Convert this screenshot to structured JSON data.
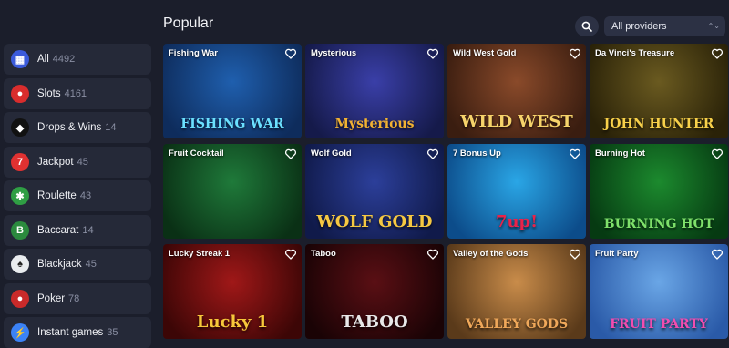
{
  "sidebar": {
    "items": [
      {
        "label": "All",
        "count": "4492",
        "icon": "all-grid-icon",
        "color": "#3b5bdb"
      },
      {
        "label": "Slots",
        "count": "4161",
        "icon": "cherries-icon",
        "color": "#d92d2d"
      },
      {
        "label": "Drops & Wins",
        "count": "14",
        "icon": "drops-wins-icon",
        "color": "#111111"
      },
      {
        "label": "Jackpot",
        "count": "45",
        "icon": "jackpot-777-icon",
        "color": "#e03131"
      },
      {
        "label": "Roulette",
        "count": "43",
        "icon": "roulette-icon",
        "color": "#2f9e44"
      },
      {
        "label": "Baccarat",
        "count": "14",
        "icon": "baccarat-icon",
        "color": "#2b8a3e"
      },
      {
        "label": "Blackjack",
        "count": "45",
        "icon": "cards-icon",
        "color": "#e9ecef"
      },
      {
        "label": "Poker",
        "count": "78",
        "icon": "poker-chip-icon",
        "color": "#c92a2a"
      },
      {
        "label": "Instant games",
        "count": "35",
        "icon": "lightning-icon",
        "color": "#3b82f6"
      }
    ]
  },
  "main": {
    "title": "Popular",
    "provider_select": {
      "value": "All providers"
    },
    "games": [
      {
        "name": "Fishing War",
        "logo": "FISHING WAR",
        "bg1": "#1f5fae",
        "bg2": "#0e2c5c",
        "logo_color": "#6be0ff"
      },
      {
        "name": "Mysterious",
        "logo": "Mysterious",
        "bg1": "#3a3fa8",
        "bg2": "#151a4a",
        "logo_color": "#f2b233"
      },
      {
        "name": "Wild West Gold",
        "logo": "WILD WEST",
        "bg1": "#8a4a2a",
        "bg2": "#3a1d10",
        "logo_color": "#f6d36b"
      },
      {
        "name": "Da Vinci's Treasure",
        "logo": "JOHN HUNTER",
        "bg1": "#6a5a20",
        "bg2": "#2a2208",
        "logo_color": "#f7d04a"
      },
      {
        "name": "Fruit Cocktail",
        "logo": "",
        "bg1": "#1f7a3a",
        "bg2": "#0a3015",
        "logo_color": "#ff3b3b"
      },
      {
        "name": "Wolf Gold",
        "logo": "WOLF GOLD",
        "bg1": "#2c3f9a",
        "bg2": "#101a4a",
        "logo_color": "#f5c842"
      },
      {
        "name": "7 Bonus Up",
        "logo": "7up!",
        "bg1": "#2aa6e6",
        "bg2": "#0c4c8a",
        "logo_color": "#e8234a"
      },
      {
        "name": "Burning Hot",
        "logo": "BURNING HOT",
        "bg1": "#1c8a2e",
        "bg2": "#063a12",
        "logo_color": "#7ee06a"
      },
      {
        "name": "Lucky Streak 1",
        "logo": "Lucky 1",
        "bg1": "#a01818",
        "bg2": "#3c0606",
        "logo_color": "#f7c73a"
      },
      {
        "name": "Taboo",
        "logo": "TABOO",
        "bg1": "#5a0f14",
        "bg2": "#1a0305",
        "logo_color": "#e8e8e8"
      },
      {
        "name": "Valley of the Gods",
        "logo": "VALLEY GODS",
        "bg1": "#c98c4a",
        "bg2": "#5a3a1a",
        "logo_color": "#f0a85a"
      },
      {
        "name": "Fruit Party",
        "logo": "FRUIT PARTY",
        "bg1": "#6aa6e6",
        "bg2": "#2a5aa8",
        "logo_color": "#f24db0"
      }
    ]
  }
}
